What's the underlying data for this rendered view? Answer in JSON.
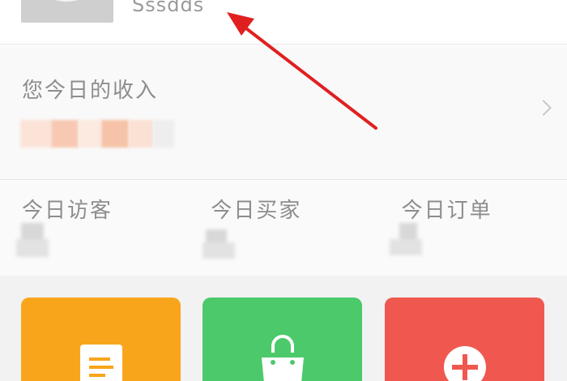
{
  "profile": {
    "username": "Sssdds"
  },
  "income": {
    "label": "您今日的收入"
  },
  "stats": [
    {
      "label": "今日访客"
    },
    {
      "label": "今日买家"
    },
    {
      "label": "今日订单"
    }
  ],
  "actions": [
    {
      "icon": "document-icon"
    },
    {
      "icon": "shopping-bag-icon"
    },
    {
      "icon": "plus-circle-icon"
    }
  ],
  "colors": {
    "tile_orange": "#f9a51c",
    "tile_green": "#4cc96b",
    "tile_red": "#f0584f",
    "arrow_red": "#e02020"
  }
}
